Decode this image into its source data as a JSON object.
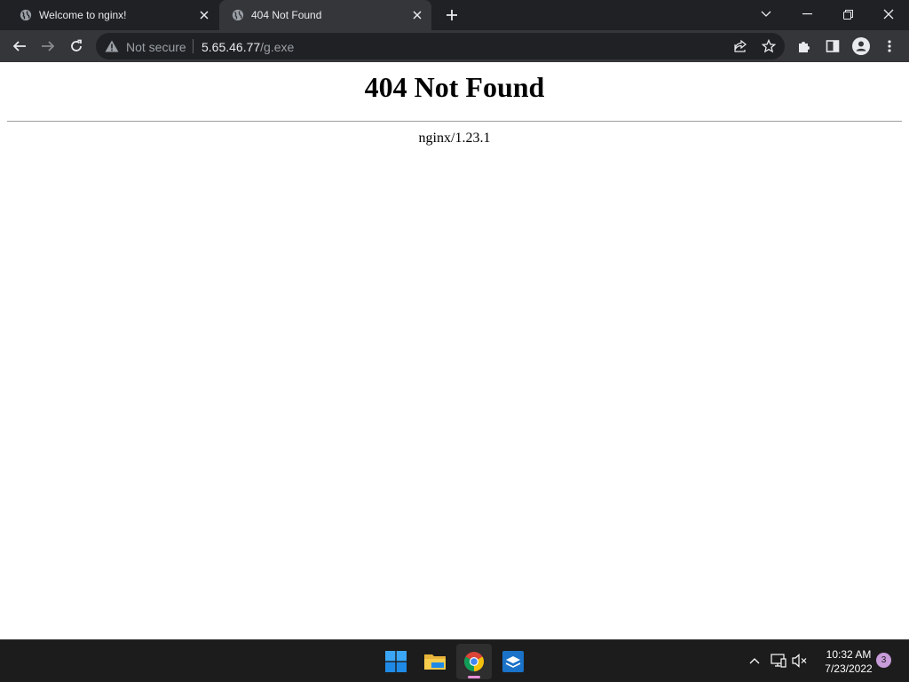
{
  "browser": {
    "tabs": [
      {
        "title": "Welcome to nginx!",
        "active": false,
        "favicon": "globe-icon"
      },
      {
        "title": "404 Not Found",
        "active": true,
        "favicon": "globe-icon"
      }
    ],
    "toolbar": {
      "security_label": "Not secure",
      "url_host": "5.65.46.77",
      "url_path": "/g.exe"
    }
  },
  "page": {
    "heading": "404 Not Found",
    "server": "nginx/1.23.1"
  },
  "taskbar": {
    "apps": [
      "start-icon",
      "file-explorer-icon",
      "chrome-icon",
      "app-icon"
    ],
    "clock_time": "10:32 AM",
    "clock_date": "7/23/2022",
    "notification_count": "3"
  },
  "colors": {
    "chrome_dark": "#202124",
    "chrome_toolbar": "#35363a",
    "page_bg": "#ffffff",
    "taskbar_bg": "#1c1c1c",
    "notif_badge": "#c89bd9"
  }
}
